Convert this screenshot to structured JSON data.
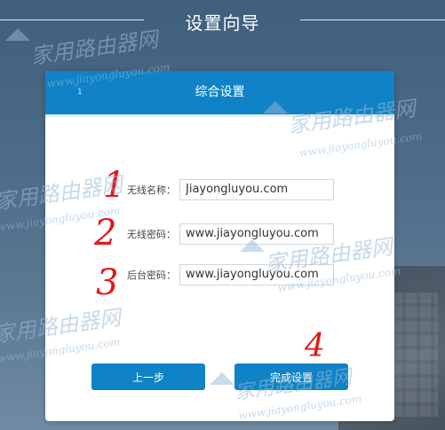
{
  "header": {
    "title": "设置向导"
  },
  "panel": {
    "title": "综合设置",
    "head_number": "1"
  },
  "form": {
    "fields": [
      {
        "label": "无线名称：",
        "value": "Jiayongluyou.com",
        "marker": "1"
      },
      {
        "label": "无线密码：",
        "value": "www.jiayongluyou.com",
        "marker": "2"
      },
      {
        "label": "后台密码：",
        "value": "www.jiayongluyou.com",
        "marker": "3"
      }
    ]
  },
  "buttons": {
    "prev_label": "上一步",
    "finish_label": "完成设置",
    "finish_marker": "4"
  },
  "watermarks": {
    "brand_cn": "家用路由器网",
    "url": "www.jiayongluyou.com"
  },
  "colors": {
    "accent": "#0f83c6",
    "annotation": "#e01818"
  }
}
